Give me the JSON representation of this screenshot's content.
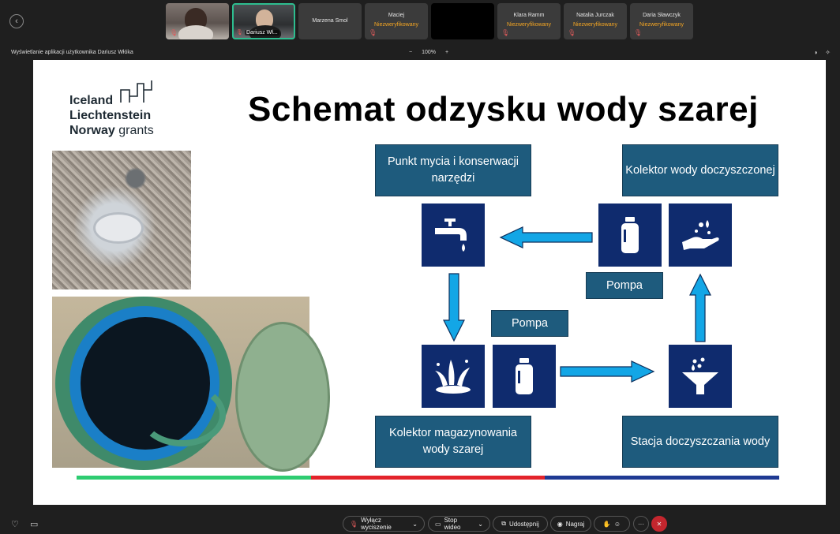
{
  "participants": [
    {
      "name": "",
      "kind": "video",
      "muted": true
    },
    {
      "name": "Dariusz Wł...",
      "kind": "video",
      "muted": true,
      "active": true
    },
    {
      "name": "Marzena Smol",
      "kind": "name",
      "muted": false
    },
    {
      "name": "Maciej",
      "status": "Niezweryfikowany",
      "muted": true
    },
    {
      "name": "",
      "kind": "black"
    },
    {
      "name": "Klara Ramm",
      "status": "Niezweryfikowany",
      "muted": true
    },
    {
      "name": "Natalia Jurczak",
      "status": "Niezweryfikowany",
      "muted": true
    },
    {
      "name": "Daria Sławczyk",
      "status": "Niezweryfikowany",
      "muted": true
    }
  ],
  "share": {
    "label": "Wyświetlanie aplikacji użytkownika Dariusz Włóka",
    "zoom_minus": "−",
    "zoom": "100%",
    "zoom_plus": "+"
  },
  "slide": {
    "logo": {
      "line1": "Iceland",
      "line2": "Liechtenstein",
      "line3a": "Norway",
      "line3b": "grants"
    },
    "title": "Schemat odzysku wody szarej",
    "boxes": {
      "wash": "Punkt mycia i konserwacji narzędzi",
      "collector_clean": "Kolektor wody doczyszczonej",
      "pump1": "Pompa",
      "pump2": "Pompa",
      "storage": "Kolektor magazynowania wody szarej",
      "station": "Stacja doczyszczania wody"
    },
    "icons": [
      "faucet-icon",
      "pump-icon",
      "hand-water-icon",
      "splash-icon",
      "pump-icon",
      "filter-funnel-icon"
    ],
    "stripe_colors": [
      "#2ecc71",
      "#e3242b",
      "#1f3a93"
    ]
  },
  "toolbar": {
    "mute": "Wyłącz wyciszenie",
    "video": "Stop wideo",
    "share": "Udostępnij",
    "record": "Nagraj",
    "more": "···"
  }
}
